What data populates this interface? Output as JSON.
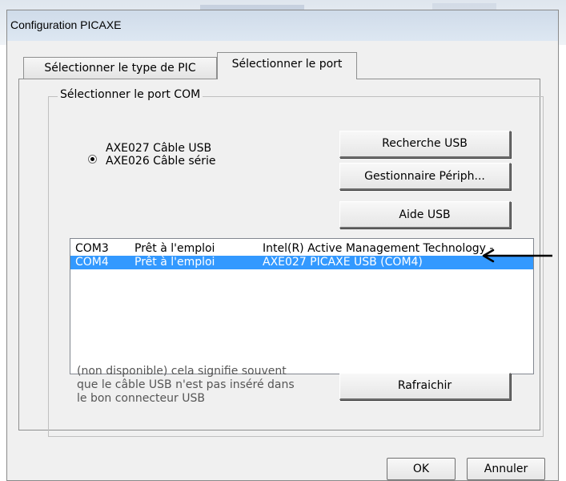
{
  "window": {
    "title": "Configuration PICAXE"
  },
  "tabs": [
    {
      "label": "Sélectionner le type de PIC",
      "active": false
    },
    {
      "label": "Sélectionner le port",
      "active": true
    }
  ],
  "group": {
    "label": "Sélectionner le port COM"
  },
  "radio_options": [
    {
      "label": "AXE027 Câble USB",
      "selected": true
    },
    {
      "label": "AXE026 Câble série",
      "selected": false
    }
  ],
  "buttons": {
    "recherche_usb": "Recherche USB",
    "gestionnaire": "Gestionnaire Périph...",
    "aide_usb": "Aide USB",
    "rafraichir": "Rafraichir",
    "ok": "OK",
    "annuler": "Annuler"
  },
  "ports": [
    {
      "port": "COM3",
      "status": "Prêt à l'emploi",
      "device": "Intel(R) Active Management Technology -",
      "selected": false
    },
    {
      "port": "COM4",
      "status": "Prêt à l'emploi",
      "device": "AXE027 PICAXE USB (COM4)",
      "selected": true
    }
  ],
  "note_lines": [
    "(non disponible) cela signifie souvent",
    "que le câble USB n'est pas inséré dans",
    "le bon connecteur USB"
  ],
  "colors": {
    "selection": "#3399ff",
    "annotation_arrow": "#000000"
  },
  "icons": {
    "annotation": "left-arrow-icon"
  }
}
